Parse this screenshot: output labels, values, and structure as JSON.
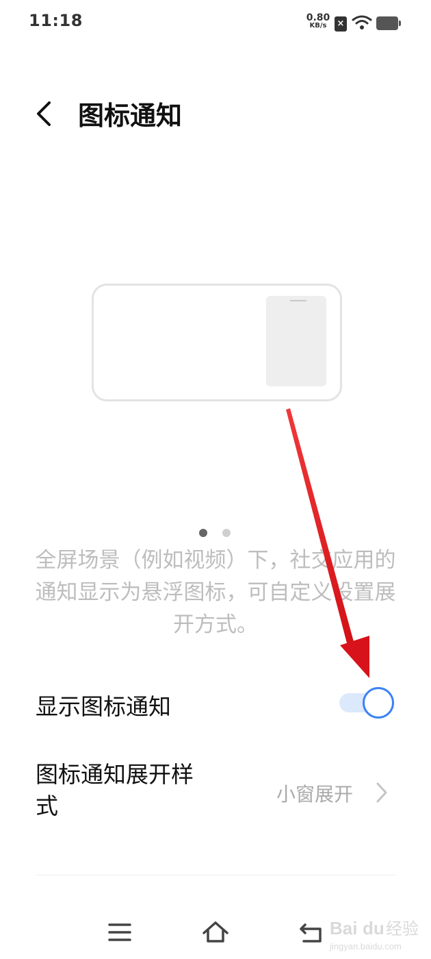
{
  "status_bar": {
    "time": "11:18",
    "net_speed_value": "0.80",
    "net_speed_unit": "KB/s",
    "sim_icon": "x-sim-icon",
    "wifi_icon": "wifi-icon",
    "battery_icon": "battery-icon"
  },
  "header": {
    "title": "图标通知",
    "back_icon": "chevron-left-icon"
  },
  "illustration": {
    "pages": 2,
    "active_page": 1
  },
  "description": "全屏场景（例如视频）下，社交应用的通知显示为悬浮图标，可自定义设置展开方式。",
  "settings": {
    "show_icon_notification": {
      "label": "显示图标通知",
      "enabled": true
    },
    "expand_style": {
      "label": "图标通知展开样式",
      "value": "小窗展开"
    }
  },
  "nav_bar": {
    "menu_icon": "menu-icon",
    "home_icon": "home-icon",
    "back_icon": "back-icon"
  },
  "watermark": {
    "brand": "Bai du 经验",
    "url": "jingyan.baidu.com"
  },
  "colors": {
    "accent": "#3b82f6",
    "toggle_track": "#dce8fb",
    "annotation_arrow": "#e0191c",
    "description_text": "#bdbdbd"
  }
}
